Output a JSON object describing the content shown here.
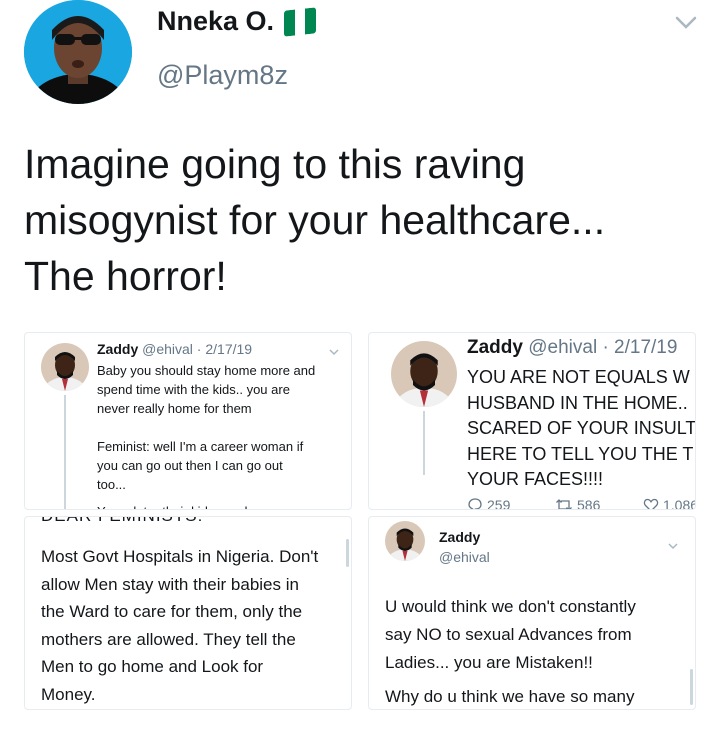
{
  "header": {
    "display_name": "Nneka O.",
    "handle": "@Playm8z"
  },
  "tweet": {
    "text_line1": "Imagine going to this raving",
    "text_line2": "misogynist for your healthcare...",
    "text_line3": "The horror!"
  },
  "card1": {
    "name": "Zaddy",
    "meta": "@ehival · 2/17/19",
    "lines": [
      "Baby you should stay home more and",
      "spend time with the kids.. you are",
      "never really home for them",
      "Feminist: well I'm a career woman if",
      "you can go out then I can go out",
      "too...",
      "Years later their kids are drug"
    ]
  },
  "card2": {
    "name": "Zaddy",
    "meta": "@ehival · 2/17/19",
    "lines": [
      "YOU ARE NOT EQUALS W",
      "HUSBAND IN THE HOME..",
      "SCARED OF YOUR INSULT",
      "HERE TO TELL YOU THE T",
      "YOUR FACES!!!!"
    ],
    "replies": "259",
    "retweets": "586",
    "likes": "1,086"
  },
  "card3": {
    "cut_heading": "DEAR FEMINISTS:",
    "lines": [
      "Most Govt Hospitals in Nigeria. Don't",
      "allow Men stay with their babies in",
      "the Ward to care for them, only the",
      "mothers are allowed. They tell the",
      "Men to go home and Look for",
      "Money."
    ]
  },
  "card4": {
    "name": "Zaddy",
    "handle": "@ehival",
    "lines": [
      "U would think we don't constantly",
      "say NO to sexual Advances from",
      "Ladies... you are Mistaken!!",
      "Why do u think we have so many"
    ]
  },
  "colors": {
    "text": "#14171a",
    "secondary": "#657786",
    "border": "#e6ecf0",
    "flag_green": "#008751",
    "flag_white": "#ffffff",
    "avatar_bg": "#1aa6e0"
  }
}
